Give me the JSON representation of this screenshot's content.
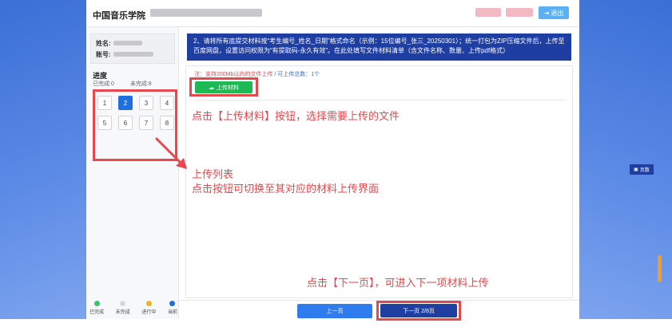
{
  "header": {
    "school_name": "中国音乐学院",
    "exit_label": "退出"
  },
  "sidebar": {
    "name_label": "姓名:",
    "account_label": "账号:",
    "progress_title": "进度",
    "completed_label": "已完成:0",
    "uncompleted_label": "未完成:8",
    "steps": [
      "1",
      "2",
      "3",
      "4",
      "5",
      "6",
      "7",
      "8"
    ],
    "active_step": "2",
    "legend": [
      {
        "label": "已完成",
        "color": "#3cc26b"
      },
      {
        "label": "未完成",
        "color": "#d6d8dd"
      },
      {
        "label": "进行中",
        "color": "#f1b51c"
      },
      {
        "label": "当前",
        "color": "#1e6fe0"
      }
    ]
  },
  "main": {
    "notice": "2、请将所有底提交材料按“考生编号_姓名_日期”格式命名（示例：15位编号_张三_20250301）；统一打包为ZIP压缩文件后，上传至百度网盘，设置访问权限为“有提取码-永久有效”。在此处填写文件材料清单（含文件名称、数量、上传pdf格式）",
    "hint_prefix": "注：支持200Mb以内的文件上传",
    "hint_suffix": "/ 可上传总数：1个",
    "upload_label": "上传材料",
    "annotation_upload": "点击【上传材料】按钮，选择需要上传的文件",
    "annotation_list_line1": "上传列表",
    "annotation_list_line2": "点击按钮可切换至其对应的材料上传界面",
    "annotation_next": "点击【下一页】，可进入下一项材料上传"
  },
  "footer": {
    "prev_label": "上一页",
    "next_label": "下一页 2/8页"
  },
  "float_button": {
    "label": "页数"
  },
  "colors": {
    "primary": "#1f3ea1",
    "accent": "#2f7cf0",
    "annotation": "#e5484d",
    "upload": "#1db954"
  }
}
